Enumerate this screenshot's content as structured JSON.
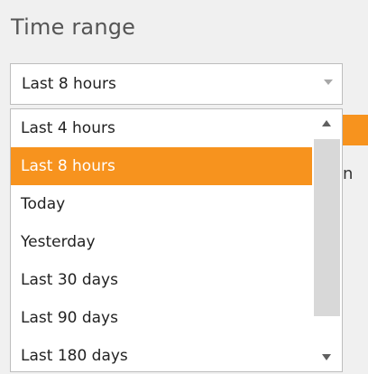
{
  "title": "Time range",
  "select": {
    "value": "Last 8 hours"
  },
  "background": {
    "partial_text": "n"
  },
  "options": [
    {
      "label": "Last 4 hours",
      "selected": false
    },
    {
      "label": "Last 8 hours",
      "selected": true
    },
    {
      "label": "Today",
      "selected": false
    },
    {
      "label": "Yesterday",
      "selected": false
    },
    {
      "label": "Last 30 days",
      "selected": false
    },
    {
      "label": "Last 90 days",
      "selected": false
    },
    {
      "label": "Last 180 days",
      "selected": false
    }
  ],
  "colors": {
    "accent": "#f7931e",
    "panel_bg": "#f0f0f0",
    "text": "#222222"
  },
  "icons": {
    "select_arrow": "chevron-down-icon",
    "scroll_up": "scroll-up-arrow-icon",
    "scroll_down": "scroll-down-arrow-icon"
  }
}
